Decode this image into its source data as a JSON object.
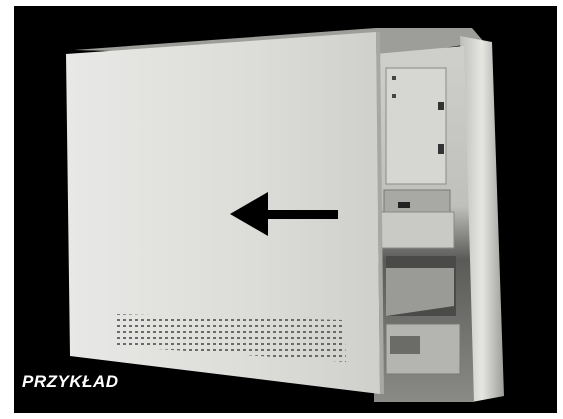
{
  "caption": "PRZYKŁAD"
}
